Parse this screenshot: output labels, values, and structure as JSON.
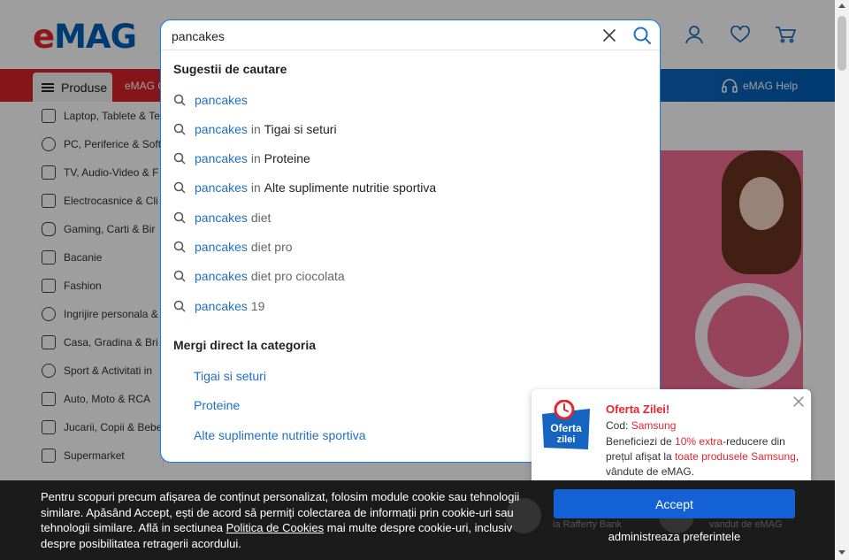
{
  "header": {
    "logo_e": "e",
    "logo_mag": "MAG",
    "icons": [
      "account-icon",
      "favorites-icon",
      "cart-icon"
    ]
  },
  "nav": {
    "produse_label": "Produse",
    "emag_g_label": "eMAG G",
    "help_label": "eMAG Help"
  },
  "sidebar": {
    "items": [
      {
        "label": "Laptop, Tablete & Te",
        "icon": "laptop-icon"
      },
      {
        "label": "PC, Periferice & Soft",
        "icon": "mouse-icon"
      },
      {
        "label": "TV, Audio-Video & F",
        "icon": "camera-icon"
      },
      {
        "label": "Electrocasnice & Cli",
        "icon": "washing-machine-icon"
      },
      {
        "label": "Gaming, Carti & Bir",
        "icon": "gamepad-icon"
      },
      {
        "label": "Bacanie",
        "icon": "bag-icon"
      },
      {
        "label": "Fashion",
        "icon": "tshirt-icon"
      },
      {
        "label": "Ingrijire personala &",
        "icon": "care-icon"
      },
      {
        "label": "Casa, Gradina & Bri",
        "icon": "home-icon"
      },
      {
        "label": "Sport & Activitati in",
        "icon": "sport-icon"
      },
      {
        "label": "Auto, Moto & RCA",
        "icon": "car-icon"
      },
      {
        "label": "Jucarii, Copii & Bebe",
        "icon": "toy-icon"
      },
      {
        "label": "Supermarket",
        "icon": "cart-icon"
      }
    ]
  },
  "search": {
    "query": "pancakes",
    "suggestions_title": "Sugestii de cautare",
    "suggestions": [
      {
        "keyword": "pancakes",
        "connector": "",
        "rest": ""
      },
      {
        "keyword": "pancakes",
        "connector": " in ",
        "rest": "Tigai si seturi"
      },
      {
        "keyword": "pancakes",
        "connector": " in ",
        "rest": "Proteine"
      },
      {
        "keyword": "pancakes",
        "connector": " in ",
        "rest": "Alte suplimente nutritie sportiva"
      },
      {
        "keyword": "pancakes",
        "connector": " diet",
        "rest": ""
      },
      {
        "keyword": "pancakes",
        "connector": " diet pro",
        "rest": ""
      },
      {
        "keyword": "pancakes",
        "connector": " diet pro ciocolata",
        "rest": ""
      },
      {
        "keyword": "pancakes",
        "connector": " 19",
        "rest": ""
      }
    ],
    "categories_title": "Mergi direct la categoria",
    "categories": [
      "Tigai si seturi",
      "Proteine",
      "Alte suplimente nutritie sportiva"
    ]
  },
  "deal": {
    "badge_line1": "Oferta",
    "badge_line2": "zilei",
    "title": "Oferta Zilei!",
    "code_label": "Cod: ",
    "code_value": "Samsung",
    "text_1": "Beneficiezi de ",
    "text_red_1": "10% extra",
    "text_2": "-reducere din prețul afișat la ",
    "text_red_2": "toate produsele Samsung",
    "text_3": ", vândute de eMAG."
  },
  "cookie": {
    "text_before": "Pentru scopuri precum afișarea de conținut personalizat, folosim module cookie sau tehnologii similare. Apăsând Accept, ești de acord să permiți colectarea de informații prin cookie-uri sau tehnologii similare. Află in sectiunea ",
    "link": "Politica de Cookies",
    "text_after": " mai multe despre cookie-uri, inclusiv despre posibilitatea retragerii acordului.",
    "accept_label": "Accept",
    "prefs_label": "administreaza preferintele",
    "ghost_1": "la Rafferty Bank",
    "ghost_2": "vandut de eMAG"
  },
  "colors": {
    "brand_red": "#e5262d",
    "brand_blue": "#005eb8",
    "link_blue": "#1f6fc5",
    "accept_blue": "#1461d6"
  }
}
